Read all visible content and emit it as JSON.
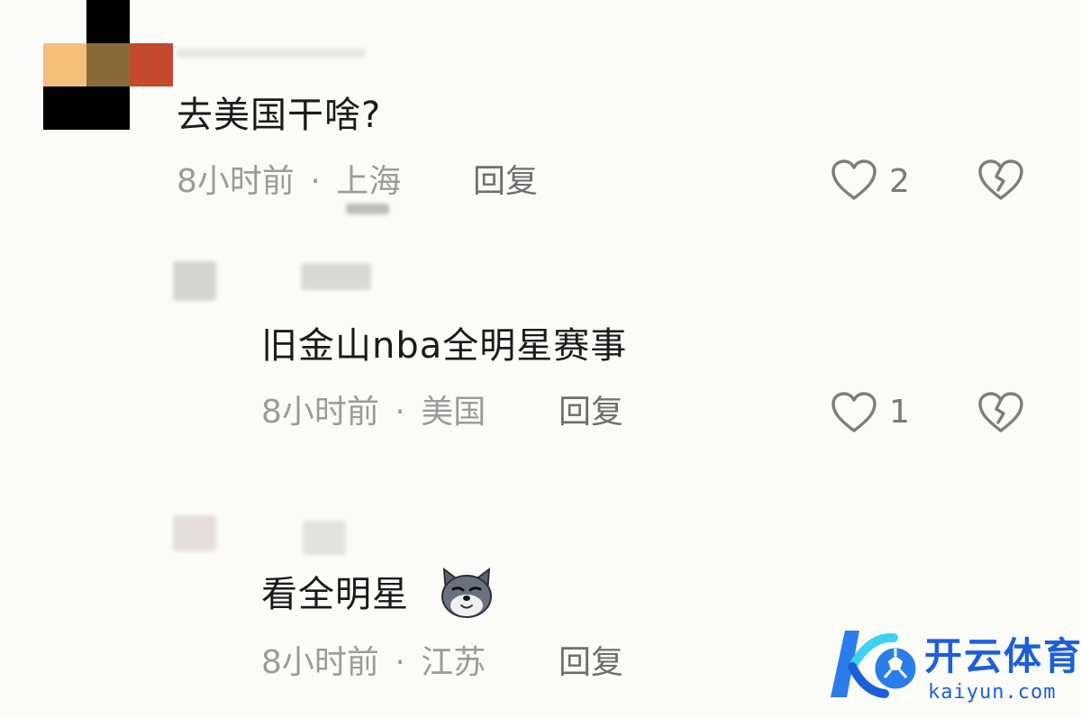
{
  "comments": [
    {
      "text": "去美国干啥?",
      "time": "8小时前",
      "separator": "·",
      "location": "上海",
      "reply_label": "回复",
      "likes": "2"
    },
    {
      "text": "旧金山nba全明星赛事",
      "time": "8小时前",
      "separator": "·",
      "location": "美国",
      "reply_label": "回复",
      "likes": "1"
    },
    {
      "text": "看全明星",
      "emoji": "dog-emoji",
      "time": "8小时前",
      "separator": "·",
      "location": "江苏",
      "reply_label": "回复"
    }
  ],
  "watermark": {
    "brand": "开云体育",
    "domain": "kaiyun.com",
    "color": "#1d5fd8"
  },
  "icons": {
    "like": "heart-outline-icon",
    "dislike": "broken-heart-icon"
  }
}
